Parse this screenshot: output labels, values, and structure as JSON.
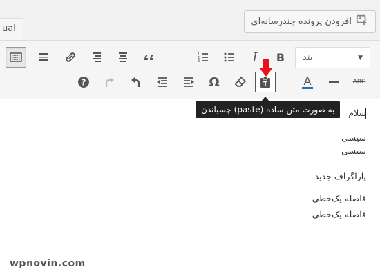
{
  "tabs": {
    "visual_label": "ual"
  },
  "add_media": {
    "label": "افزودن پرونده چندرسانه‌ای",
    "icon": "add-media-icon"
  },
  "toolbar": {
    "format_select": {
      "value": "بند"
    },
    "row1_icons": [
      "kitchen-sink-toggle-icon",
      "horizontal-line-icon",
      "link-icon",
      "align-right-icon",
      "align-center-icon",
      "blockquote-icon",
      "numbered-list-icon",
      "bullet-list-icon",
      "italic-icon",
      "bold-icon"
    ],
    "row1_italic_label": "I",
    "row1_bold_label": "B",
    "row2_icons": [
      "help-icon",
      "redo-icon",
      "undo-icon",
      "outdent-icon",
      "indent-icon",
      "special-character-icon",
      "clear-formatting-icon",
      "paste-as-text-icon",
      "text-color-icon",
      "horizontal-rule-icon",
      "strikethrough-icon"
    ],
    "omega_label": "Ω",
    "text_color_label": "A",
    "strike_label": "ABC"
  },
  "tooltip": {
    "text": "به صورت متن ساده (paste) چسباندن"
  },
  "editor": {
    "lines": [
      "سلام",
      "سیسی",
      "سیسی",
      "پاراگراف جدید",
      "فاصله یک‌خطی",
      "فاصله یک‌خطی"
    ]
  },
  "watermark": {
    "text": "wpnovin.com"
  },
  "colors": {
    "accent_red": "#e8141b",
    "toolbar_bg": "#f5f5f5",
    "text_color_underline": "#2271b1"
  }
}
